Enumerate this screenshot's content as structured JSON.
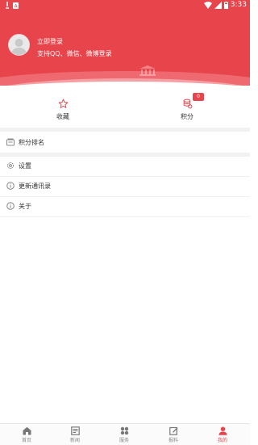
{
  "status_bar": {
    "time": "3:33"
  },
  "profile": {
    "login_title": "立即登录",
    "login_subtitle": "支持QQ、微信、微博登录"
  },
  "quick_actions": [
    {
      "label": "收藏",
      "icon": "star-icon"
    },
    {
      "label": "积分",
      "icon": "coins-icon",
      "badge": "0"
    }
  ],
  "menu_items": [
    {
      "label": "积分排名",
      "icon": "ranking-icon"
    },
    {
      "label": "设置",
      "icon": "gear-icon"
    },
    {
      "label": "更新通讯录",
      "icon": "info-icon"
    },
    {
      "label": "关于",
      "icon": "info-icon"
    }
  ],
  "tab_bar": [
    {
      "label": "首页",
      "icon": "home-icon",
      "active": false
    },
    {
      "label": "新闻",
      "icon": "news-icon",
      "active": false
    },
    {
      "label": "服务",
      "icon": "grid-icon",
      "active": false
    },
    {
      "label": "报料",
      "icon": "report-icon",
      "active": false
    },
    {
      "label": "我的",
      "icon": "user-icon",
      "active": true
    }
  ],
  "colors": {
    "accent": "#e8444c",
    "divider": "#f1f1f1"
  }
}
